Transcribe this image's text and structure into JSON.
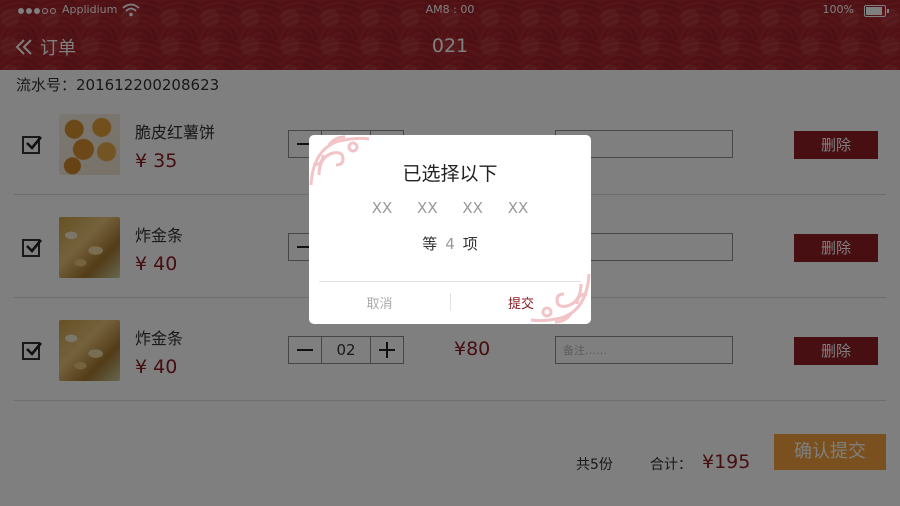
{
  "status_bar": {
    "carrier": "Applidium",
    "time": "AM8 : 00",
    "battery": "100%",
    "battery_level": 1.0
  },
  "header": {
    "back_label": "订单",
    "title": "021"
  },
  "order": {
    "serial_label": "流水号：201612200208623"
  },
  "items": [
    {
      "name": "脆皮红薯饼",
      "price": "¥ 35",
      "qty": "",
      "line_total": "",
      "note_placeholder": "",
      "delete_label": "删除",
      "checked": true
    },
    {
      "name": "炸金条",
      "price": "¥ 40",
      "qty": "",
      "line_total": "",
      "note_placeholder": "",
      "delete_label": "删除",
      "checked": true
    },
    {
      "name": "炸金条",
      "price": "¥ 40",
      "qty": "02",
      "line_total": "¥80",
      "note_placeholder": "备注……",
      "delete_label": "删除",
      "checked": true
    }
  ],
  "footer": {
    "count": "共5份",
    "total_label": "合计：",
    "total_amount": "¥195",
    "confirm_label": "确认提交"
  },
  "modal": {
    "title": "已选择以下",
    "items": [
      "XX",
      "XX",
      "XX",
      "XX"
    ],
    "count_prefix": "等",
    "count_value": "4",
    "count_suffix": "项",
    "cancel_label": "取消",
    "submit_label": "提交"
  },
  "colors": {
    "header_red": "#a5222a",
    "accent_red": "#8b1c22",
    "delete_button": "#8f1e25",
    "confirm_orange": "#f4a23c"
  },
  "icons": [
    "signal-icon",
    "wifi-icon",
    "battery-icon",
    "double-chevron-left-icon",
    "checkbox-checked-icon",
    "minus-icon",
    "plus-icon",
    "ornament-icon"
  ]
}
